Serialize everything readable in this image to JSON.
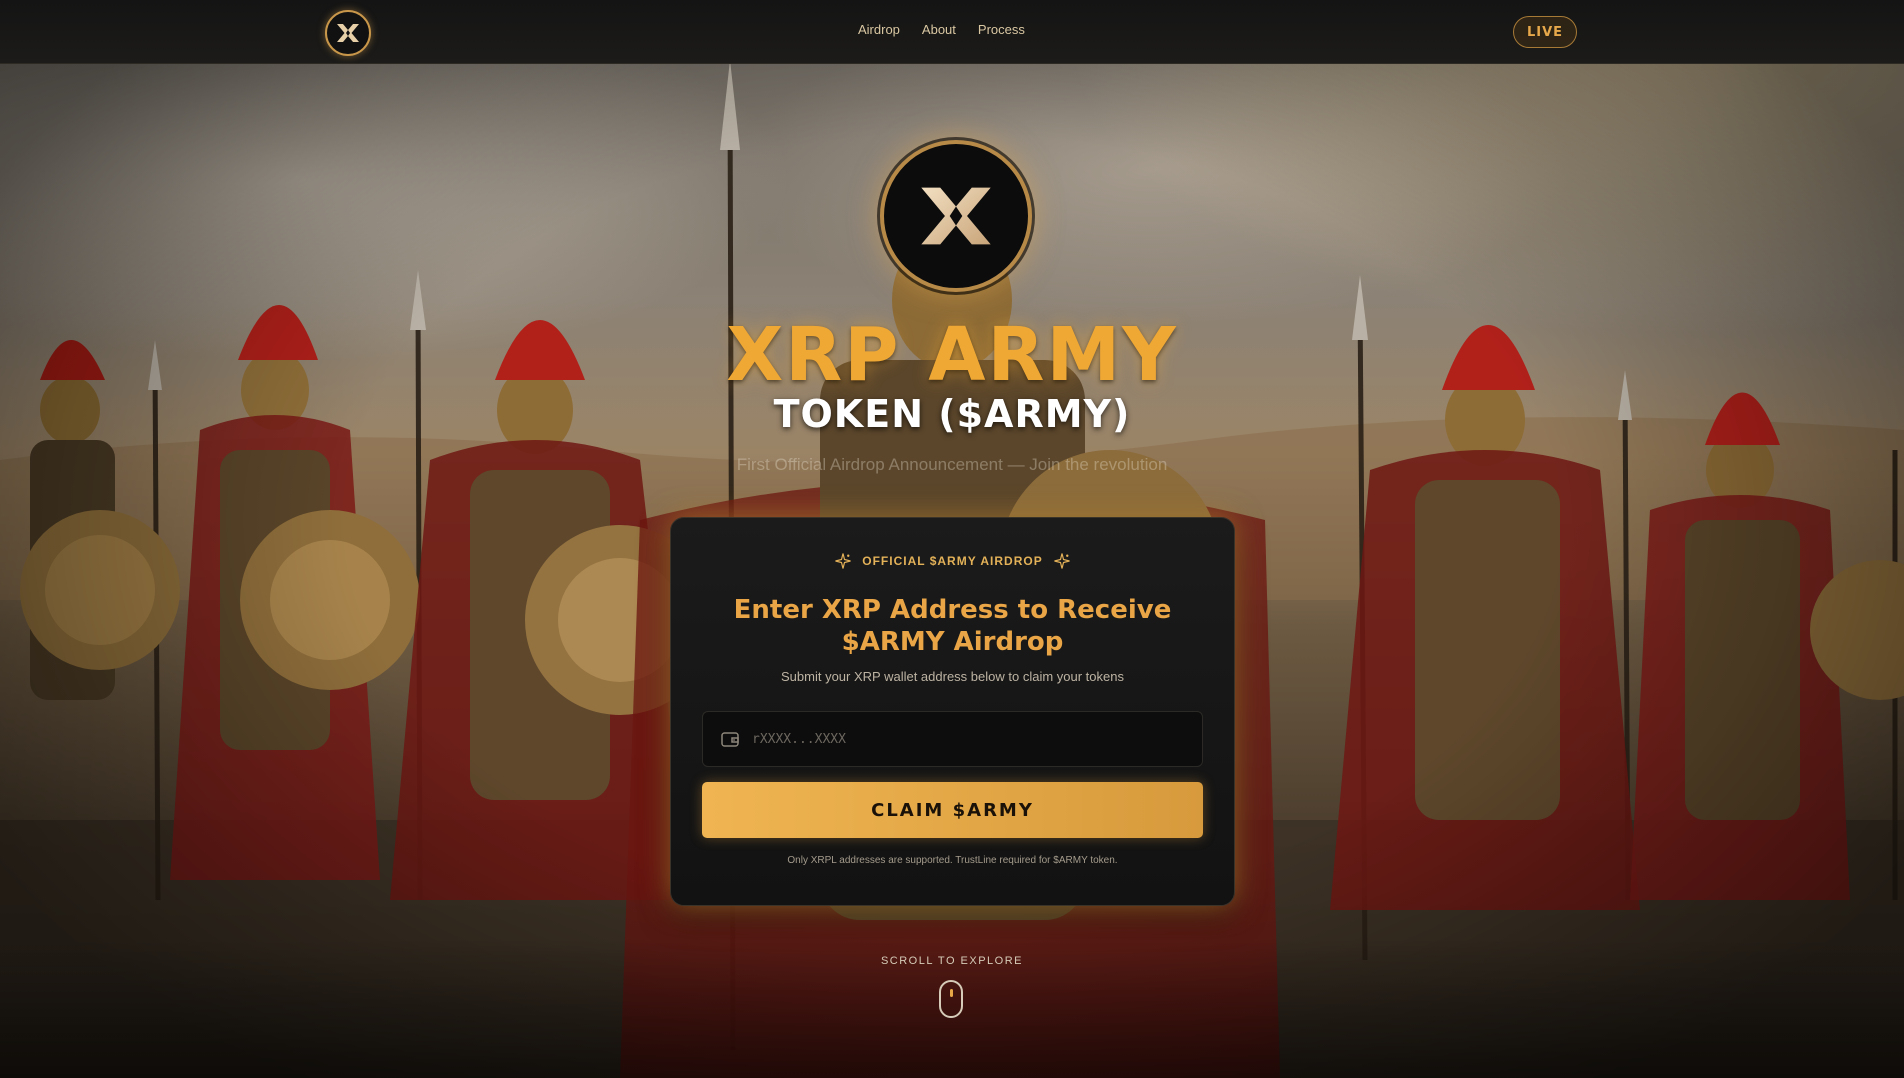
{
  "nav": {
    "links": [
      "Airdrop",
      "About",
      "Process"
    ],
    "live_label": "LIVE"
  },
  "hero": {
    "title": "XRP ARMY",
    "subtitle": "TOKEN ($ARMY)",
    "announcement": "First Official Airdrop Announcement — Join the revolution"
  },
  "card": {
    "badge": "OFFICIAL $ARMY AIRDROP",
    "title": "Enter XRP Address to Receive $ARMY Airdrop",
    "description": "Submit your XRP wallet address below to claim your tokens",
    "address_placeholder": "rXXXX...XXXX",
    "address_value": "",
    "claim_label": "CLAIM $ARMY",
    "note": "Only XRPL addresses are supported. TrustLine required for $ARMY token."
  },
  "scroll": {
    "label": "SCROLL TO EXPLORE"
  },
  "colors": {
    "accent": "#f0a835",
    "button_start": "#f0b552",
    "button_end": "#d79a3c",
    "card_bg": "#151515"
  },
  "icons": {
    "logo": "xrp-army-logo",
    "badge_left": "sparkle-icon",
    "badge_right": "sparkle-icon",
    "address": "wallet-icon",
    "scroll": "mouse-scroll-icon"
  }
}
